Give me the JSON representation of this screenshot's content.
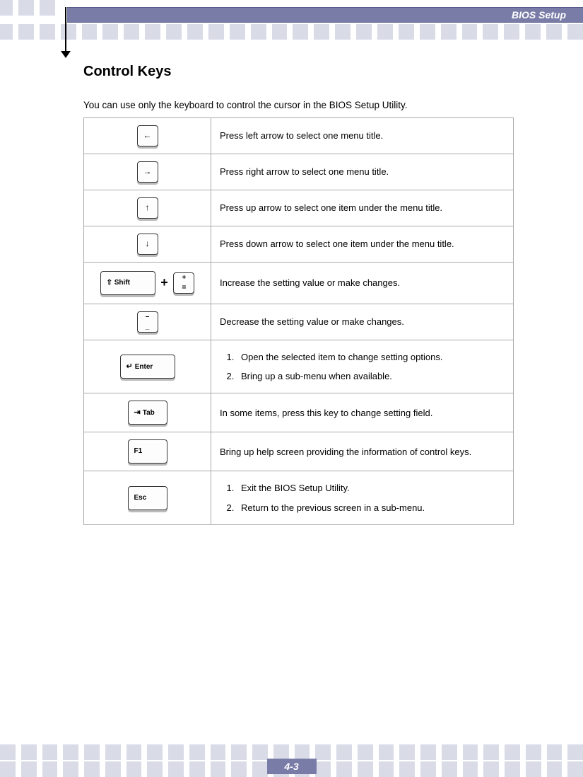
{
  "header": {
    "title": "BIOS Setup"
  },
  "section": {
    "heading": "Control Keys",
    "intro": "You can use only the keyboard to control the cursor in the BIOS Setup Utility."
  },
  "rows": [
    {
      "key_glyph": "←",
      "desc": "Press left arrow to select one menu title."
    },
    {
      "key_glyph": "→",
      "desc": "Press right arrow to select one menu title."
    },
    {
      "key_glyph": "↑",
      "desc": "Press up arrow to select one item under the menu title."
    },
    {
      "key_glyph": "↓",
      "desc": "Press down arrow to select one item under the menu title."
    },
    {
      "shift_label": "⇧ Shift",
      "plus": "+",
      "plus_key_top": "+",
      "plus_key_bot": "=",
      "desc": "Increase the setting value or make changes."
    },
    {
      "minus_top": "–",
      "minus_bot": "_",
      "desc": "Decrease the setting value or make changes."
    },
    {
      "enter_label": "Enter",
      "list": [
        "Open the selected item to change setting options.",
        "Bring up a sub-menu when available."
      ]
    },
    {
      "tab_label": "Tab",
      "desc": "In some items, press this key to change setting field."
    },
    {
      "f1_label": "F1",
      "desc": "Bring up help screen providing the information of control keys."
    },
    {
      "esc_label": "Esc",
      "list": [
        "Exit the BIOS Setup Utility.",
        "Return to the previous screen in a sub-menu."
      ]
    }
  ],
  "footer": {
    "page": "4-3"
  }
}
